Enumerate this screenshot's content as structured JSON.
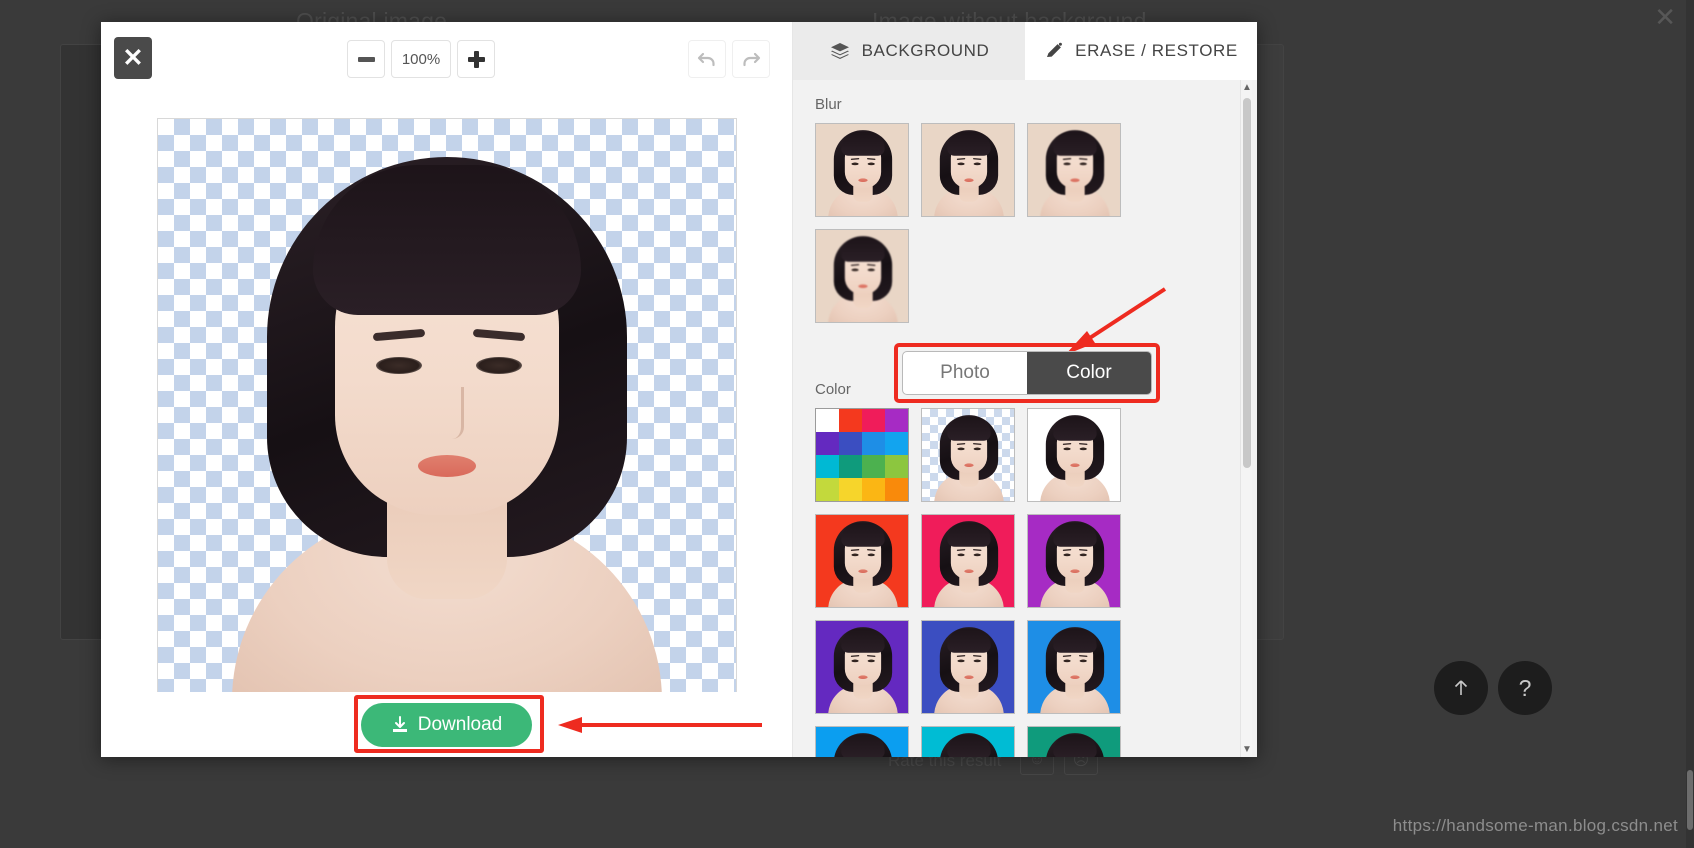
{
  "backdrop": {
    "original_label": "Original image",
    "removed_label": "Image without background",
    "rate_label": "Rate this result",
    "rate_happy_icon": "smiley-happy-icon",
    "rate_sad_icon": "smiley-sad-icon",
    "close_icon": "close-icon",
    "watermark": "https://handsome-man.blog.csdn.net",
    "fab_top_icon": "arrow-up-icon",
    "fab_help_label": "?"
  },
  "editor": {
    "close_label": "✕",
    "zoom": {
      "minus_label": "−",
      "value": "100%",
      "plus_label": "+"
    },
    "history": {
      "undo_icon": "undo-arrow-icon",
      "redo_icon": "redo-arrow-icon"
    },
    "download": {
      "label": "Download",
      "icon": "download-icon",
      "color": "#3cb878",
      "highlight_color": "#ee2b20"
    }
  },
  "panel": {
    "tabs": [
      {
        "label": "BACKGROUND",
        "icon": "layers-icon",
        "active": true
      },
      {
        "label": "ERASE / RESTORE",
        "icon": "pencil-icon",
        "active": false
      }
    ],
    "blur_section": {
      "label": "Blur",
      "items": [
        {
          "name": "blur-preset-1",
          "level": 1
        },
        {
          "name": "blur-preset-2",
          "level": 2
        },
        {
          "name": "blur-preset-3",
          "level": 3
        },
        {
          "name": "blur-preset-4",
          "level": 4
        }
      ]
    },
    "mode_toggle": {
      "options": [
        {
          "label": "Photo",
          "active": false
        },
        {
          "label": "Color",
          "active": true
        }
      ],
      "highlight_color": "#ee2b20"
    },
    "color_section": {
      "label": "Color",
      "palette_picker": {
        "name": "color-palette-picker",
        "swatches": [
          "#ffffff",
          "#f4391e",
          "#f01c5a",
          "#a62bc4",
          "#6429c0",
          "#3b4ec1",
          "#1e8ee6",
          "#12a4ef",
          "#00b9d4",
          "#0f9b7c",
          "#4cb14f",
          "#8cc63f",
          "#c3d93c",
          "#f6d52b",
          "#fbb614",
          "#f98a0b"
        ]
      },
      "swatches": [
        {
          "name": "bg-transparent",
          "color": "transparent"
        },
        {
          "name": "bg-white",
          "color": "#ffffff"
        },
        {
          "name": "bg-red",
          "color": "#f4391e"
        },
        {
          "name": "bg-pink",
          "color": "#f01c5a"
        },
        {
          "name": "bg-purple",
          "color": "#a62bc4"
        },
        {
          "name": "bg-violet",
          "color": "#6429c0"
        },
        {
          "name": "bg-indigo",
          "color": "#3b4ec1"
        },
        {
          "name": "bg-blue",
          "color": "#1e8ee6"
        },
        {
          "name": "bg-azure",
          "color": "#0b9ef0"
        },
        {
          "name": "bg-cyan",
          "color": "#00bcd4"
        },
        {
          "name": "bg-teal",
          "color": "#0f9b7c"
        }
      ]
    },
    "scrollbar": {
      "up_icon": "caret-up-icon",
      "down_icon": "caret-down-icon"
    }
  }
}
